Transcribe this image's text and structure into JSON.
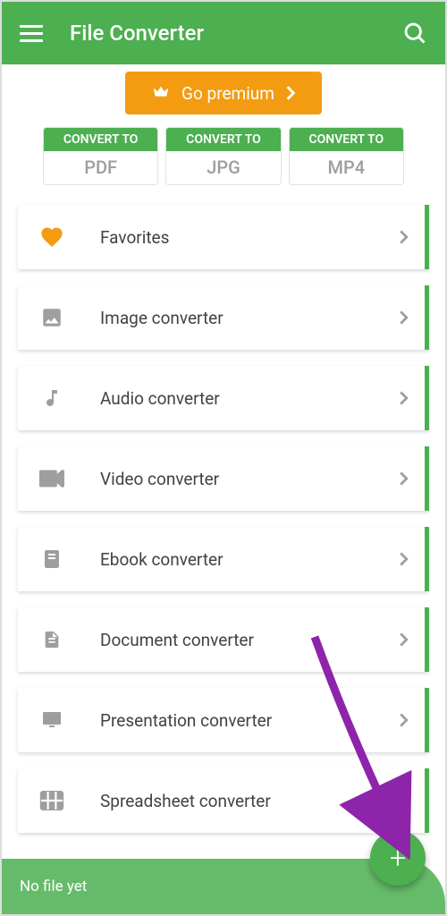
{
  "header": {
    "title": "File Converter"
  },
  "premium": {
    "label": "Go premium"
  },
  "format_cards": [
    {
      "header": "CONVERT TO",
      "format": "PDF"
    },
    {
      "header": "CONVERT TO",
      "format": "JPG"
    },
    {
      "header": "CONVERT TO",
      "format": "MP4"
    }
  ],
  "converters": [
    {
      "icon": "heart",
      "label": "Favorites"
    },
    {
      "icon": "image",
      "label": "Image converter"
    },
    {
      "icon": "music",
      "label": "Audio converter"
    },
    {
      "icon": "video",
      "label": "Video converter"
    },
    {
      "icon": "ebook",
      "label": "Ebook converter"
    },
    {
      "icon": "document",
      "label": "Document converter"
    },
    {
      "icon": "presentation",
      "label": "Presentation converter"
    },
    {
      "icon": "spreadsheet",
      "label": "Spreadsheet converter"
    }
  ],
  "bottom_bar": {
    "status": "No file yet"
  }
}
